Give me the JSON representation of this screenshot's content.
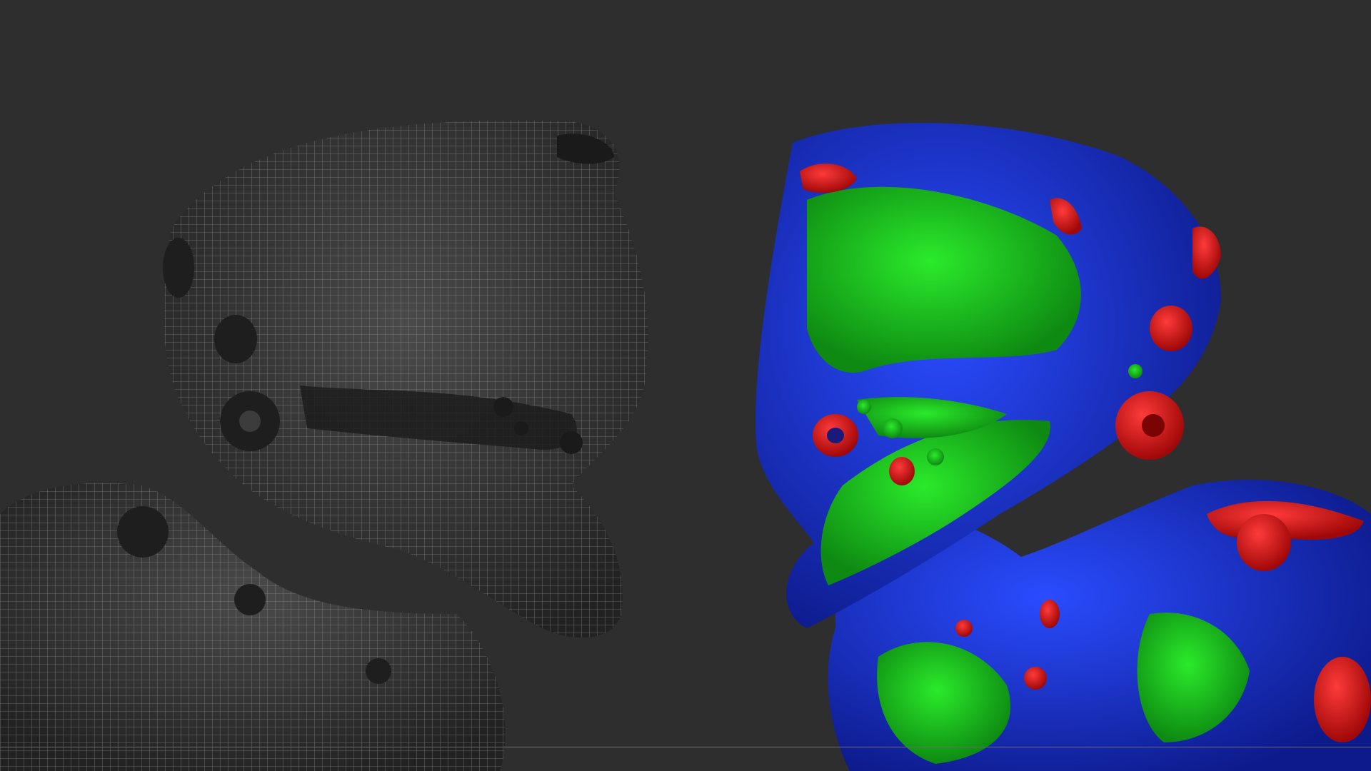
{
  "viewport": {
    "background": "#2e2e2e"
  },
  "models": {
    "wireframe": {
      "icon": "wireframe-head-model",
      "colors": {
        "base": "#3a3a3a",
        "wire": "#9a9a9a"
      }
    },
    "polygroups": {
      "icon": "polygroup-head-model",
      "colors": {
        "blue": "#1a2fd6",
        "green": "#19c21b",
        "red": "#e01414"
      }
    }
  },
  "timeline": {
    "color": "#6a6a6a"
  }
}
